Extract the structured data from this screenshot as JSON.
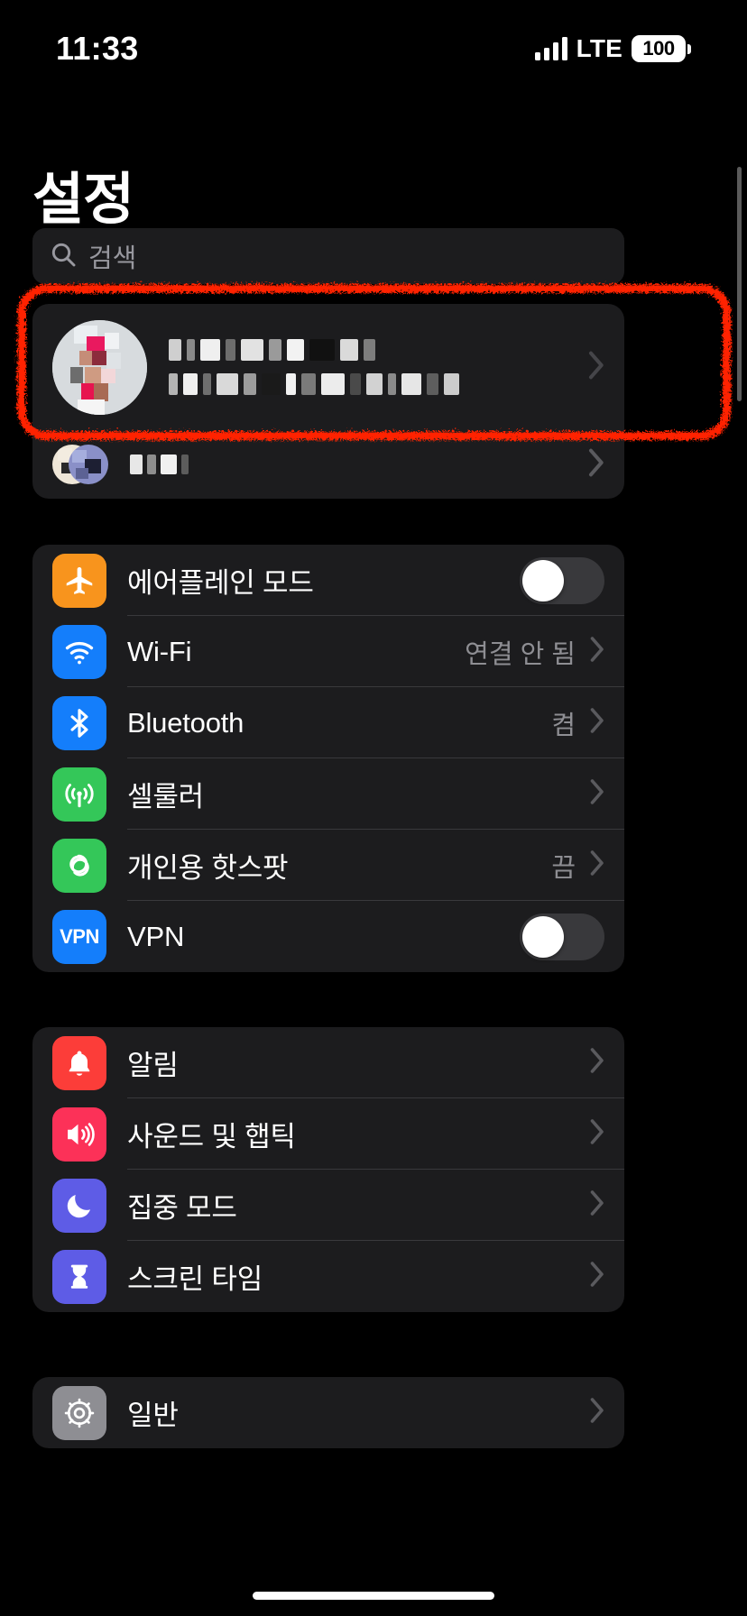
{
  "status_bar": {
    "time": "11:33",
    "network_type": "LTE",
    "battery_level": "100",
    "signal_icon": "cellular-signal-icon",
    "battery_icon": "battery-full-icon"
  },
  "header": {
    "title": "설정"
  },
  "search": {
    "placeholder": "검색",
    "icon": "search-icon"
  },
  "account": {
    "name_redacted": "",
    "subtitle_redacted": "",
    "avatar_icon": "avatar",
    "chevron_icon": "chevron-right-icon",
    "family": {
      "label_redacted": "",
      "chevron_icon": "chevron-right-icon"
    }
  },
  "annotation": {
    "shape": "red-rounded-rectangle-highlight",
    "color": "#ff2000"
  },
  "groups": [
    {
      "id": "connectivity",
      "rows": [
        {
          "label": "에어플레인 모드",
          "icon": "airplane-icon",
          "icon_color": "#f8941d",
          "accessory": "toggle",
          "toggle_on": false
        },
        {
          "label": "Wi-Fi",
          "icon": "wifi-icon",
          "icon_color": "#147efb",
          "accessory": "value",
          "value": "연결 안 됨"
        },
        {
          "label": "Bluetooth",
          "icon": "bluetooth-icon",
          "icon_color": "#147efb",
          "accessory": "value",
          "value": "켬"
        },
        {
          "label": "셀룰러",
          "icon": "cellular-icon",
          "icon_color": "#34c759",
          "accessory": "chevron",
          "value": ""
        },
        {
          "label": "개인용 핫스팟",
          "icon": "hotspot-icon",
          "icon_color": "#34c759",
          "accessory": "value",
          "value": "끔"
        },
        {
          "label": "VPN",
          "icon": "vpn-icon",
          "icon_color": "#147efb",
          "accessory": "toggle",
          "toggle_on": false
        }
      ]
    },
    {
      "id": "notifications",
      "rows": [
        {
          "label": "알림",
          "icon": "bell-icon",
          "icon_color": "#fc3d39",
          "accessory": "chevron",
          "value": ""
        },
        {
          "label": "사운드 및 햅틱",
          "icon": "speaker-icon",
          "icon_color": "#fc3158",
          "accessory": "chevron",
          "value": ""
        },
        {
          "label": "집중 모드",
          "icon": "moon-icon",
          "icon_color": "#5e5ce6",
          "accessory": "chevron",
          "value": ""
        },
        {
          "label": "스크린 타임",
          "icon": "hourglass-icon",
          "icon_color": "#5e5ce6",
          "accessory": "chevron",
          "value": ""
        }
      ]
    },
    {
      "id": "general",
      "rows": [
        {
          "label": "일반",
          "icon": "gear-icon",
          "icon_color": "#8e8e93",
          "accessory": "chevron",
          "value": ""
        }
      ]
    }
  ]
}
